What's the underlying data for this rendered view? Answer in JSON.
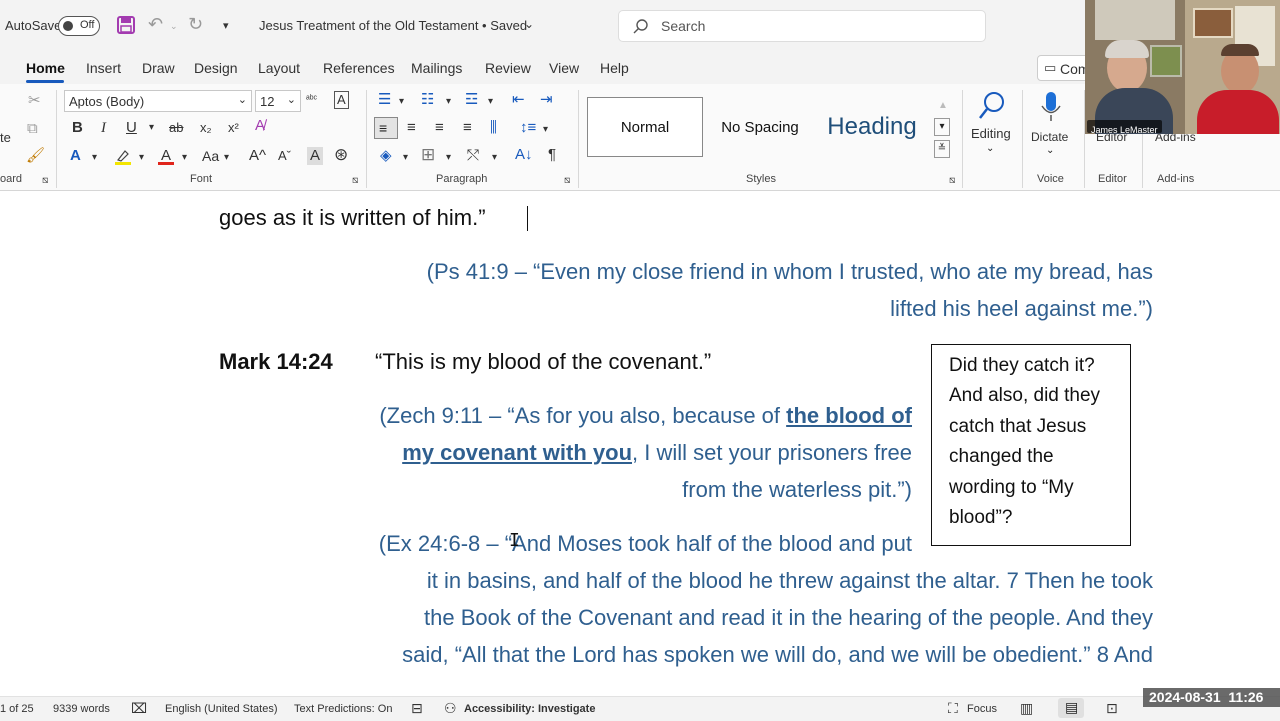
{
  "titlebar": {
    "autosave_label": "AutoSave",
    "autosave_state": "Off",
    "doc_title": "Jesus Treatment of the Old Testament • Saved",
    "search_placeholder": "Search"
  },
  "menu": {
    "tabs": [
      "Home",
      "Insert",
      "Draw",
      "Design",
      "Layout",
      "References",
      "Mailings",
      "Review",
      "View",
      "Help"
    ],
    "comments_label": "Com"
  },
  "ribbon": {
    "font_name": "Aptos (Body)",
    "font_size": "12",
    "group_clipboard": "oard",
    "group_font": "Font",
    "group_paragraph": "Paragraph",
    "group_styles": "Styles",
    "group_voice": "Voice",
    "group_editor": "Editor",
    "group_addins": "Add-ins",
    "style_normal": "Normal",
    "style_nospacing": "No Spacing",
    "style_heading": "Heading",
    "editing_label": "Editing",
    "dictate_label": "Dictate",
    "editor_label": "Editor",
    "addins_label": "Add-ins"
  },
  "video": {
    "participant_name": "James LeMaster"
  },
  "document": {
    "line1": "goes as it is written of him.”",
    "ps_line1": "(Ps 41:9 – “Even my close friend in whom I trusted, who ate my bread, has",
    "ps_line2": "lifted his heel against me.”)",
    "mark_ref": "Mark 14:24",
    "mark_quote": "“This is my blood of the covenant.”",
    "zech_line1_a": "(Zech 9:11 – “As for you also, because of ",
    "zech_line1_b": "the blood of",
    "zech_line2_a": "my covenant with you",
    "zech_line2_b": ", I will set your prisoners free",
    "zech_line3": "from the waterless pit.”)",
    "ex_line1": "(Ex 24:6-8 – “And Moses took half of the blood and put",
    "ex_line2": "it in basins, and half of the blood he threw against the altar. 7 Then he took",
    "ex_line3": "the Book of the Covenant and read it in the hearing of the people. And they",
    "ex_line4": "said, “All that the Lord has spoken we will do, and we will be obedient.” 8 And"
  },
  "callout": {
    "lines": [
      "Did they catch it?",
      "And also, did they",
      "catch that Jesus",
      "changed the",
      "wording to “My",
      "blood”?"
    ]
  },
  "statusbar": {
    "page": "1 of 25",
    "words": "9339 words",
    "language": "English (United States)",
    "predictions": "Text Predictions: On",
    "accessibility": "Accessibility: Investigate",
    "focus": "Focus",
    "datetime": "2024-08-31  11:26"
  },
  "colors": {
    "accent": "#185abd",
    "quote_blue": "#2f5f8f",
    "save_icon": "#a33bb0"
  }
}
